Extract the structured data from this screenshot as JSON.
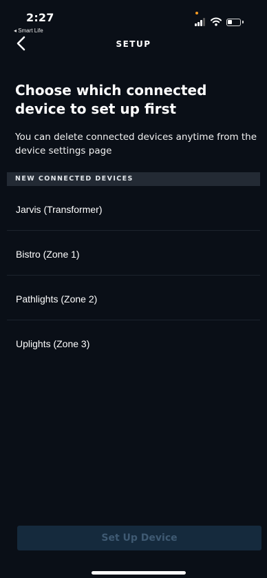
{
  "status_bar": {
    "time": "2:27",
    "back_app": "◂ Smart Life"
  },
  "nav": {
    "title": "SETUP"
  },
  "heading": {
    "title": "Choose which connected device to set up first",
    "subtitle": "You can delete connected devices anytime from the device settings page"
  },
  "section": {
    "header": "NEW CONNECTED DEVICES"
  },
  "devices": [
    {
      "label": "Jarvis (Transformer)"
    },
    {
      "label": "Bistro (Zone 1)"
    },
    {
      "label": "Pathlights (Zone 2)"
    },
    {
      "label": "Uplights (Zone 3)"
    }
  ],
  "footer": {
    "button_label": "Set Up Device",
    "button_enabled": false
  },
  "colors": {
    "background": "#0a0f17",
    "section_header_bg": "#232a34",
    "button_bg": "#152a3d",
    "button_text": "#3f5a73",
    "indicator_dot": "#f59a22"
  }
}
